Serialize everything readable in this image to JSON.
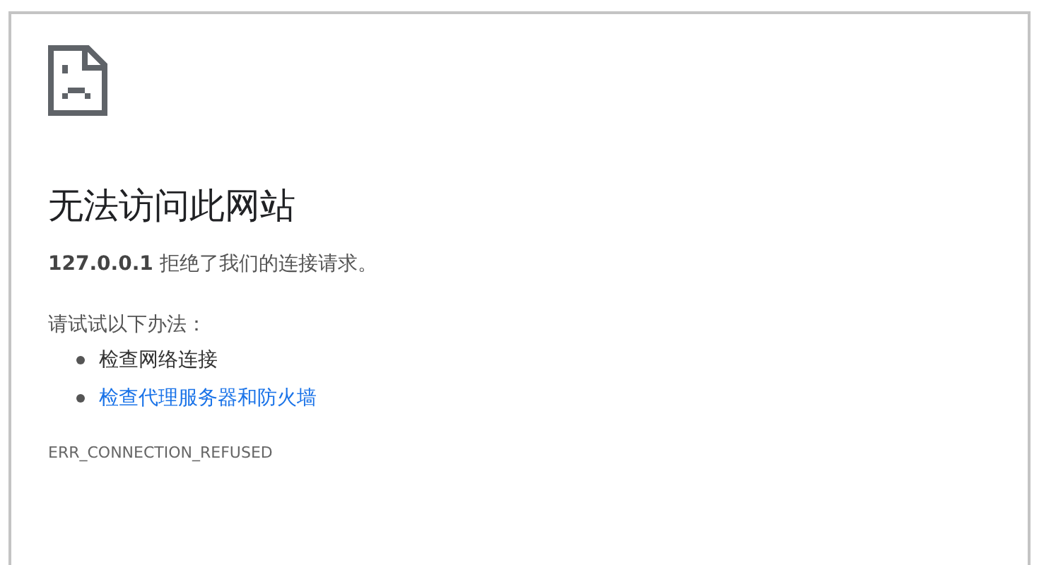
{
  "heading": "无法访问此网站",
  "message": "**127.0.0.1** 拒绝了我们的连接请求。",
  "suggestions_intro": "请试试以下办法：",
  "suggestions": [
    {
      "text": "检查网络连接",
      "kind": "text"
    },
    {
      "text": "检查代理服务器和防火墙",
      "kind": "link"
    }
  ],
  "error_code": "ERR_CONNECTION_REFUSED"
}
